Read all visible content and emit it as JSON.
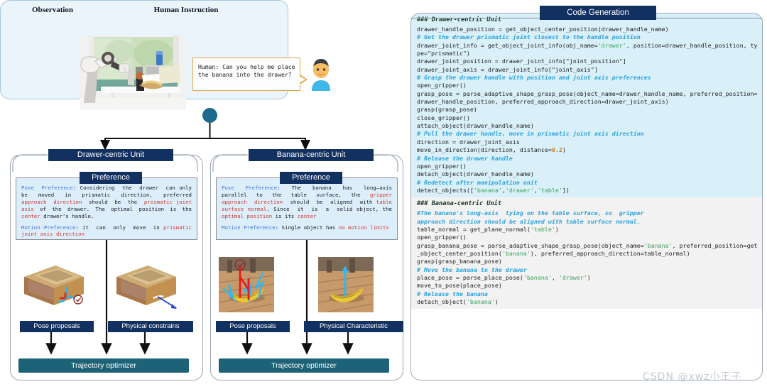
{
  "top_panel": {
    "observation_heading": "Observation",
    "instruction_heading": "Human Instruction",
    "bubble_text": "Human: Can you help me place\nthe banana into the drawer?"
  },
  "units": [
    {
      "title": "Drawer-centric Unit",
      "preference_label": "Preference",
      "pose_preference_key": "Pose Preference",
      "motion_preference_key": "Motion Preference",
      "caption_left": "Pose proposals",
      "caption_right": "Physical constrains",
      "optimizer": "Trajectory optimizer"
    },
    {
      "title": "Banana-centric Unit",
      "preference_label": "Preference",
      "pose_preference_key": "Pose Preference",
      "motion_preference_key": "Motion Preference",
      "caption_left": "Pose proposals",
      "caption_right": "Physical Characteristic",
      "optimizer": "Trajectory optimizer"
    }
  ],
  "code_panel": {
    "title": "Code Generation",
    "sections": [
      {
        "heading": "### Drawer-centric Unit",
        "code": "drawer_handle_position = get_object_center_position(drawer_handle_name)\n# Get the drawer prismatic joint closest to the handle position\ndrawer_joint_info = get_object_joint_info(obj_name='drawer', position=drawer_handle_position, type=\"prismatic\")\ndrawer_joint_position = drawer_joint_info[\"joint_position\"]\ndrawer_joint_axis = drawer_joint_info[\"joint_axis\"]\n# Grasp the drawer handle with position and joint axis preferences\nopen_gripper()\ngrasp_pose = parse_adaptive_shape_grasp_pose(object_name=drawer_handle_name, preferred_position=drawer_handle_position, preferred_approach_direction=drawer_joint_axis)\ngrasp(grasp_pose)\nclose_gripper()\nattach_object(drawer_handle_name)\n# Pull the drawer handle, move in prismatic joint axis direction\ndirection = drawer_joint_axis\nmove_in_direction(direction, distance=0.2)\n# Release the drawer handle\nopen_gripper()\ndetach_object(drawer_handle_name)\n# Redetect after manipulation unit\ndetect_objects(['banana','drawer','table'])"
      },
      {
        "heading": "### Banana-centric Unit",
        "code": "#The banana's long-axis  lying on the table surface, so  gripper\napproach direction should be aligned with table surface normal.\ntable_normal = get_plane_normal('table')\nopen_gripper()\ngrasp_banana_pose = parse_adaptive_shape_grasp_pose(object_name='banana', preferred_position=get_object_center_position('banana'), preferred_approach_direction=table_normal)\ngrasp(grasp_banana_pose)\n# Move the banana to the drawer\nplace_pose = parse_place_pose('banana', 'drawer')\nmove_to_pose(place_pose)\n# Release the banana\ndetach_object('banana')"
      }
    ]
  },
  "watermark": "CSDN @xwz小王子",
  "colors": {
    "navy": "#123060",
    "teal": "#1d6277",
    "panel_blue": "#eaf4fb",
    "pref_blue": "#ddeefb",
    "code_blue": "#d9f0f8",
    "code_gray": "#f2f2f2",
    "keyword_blue": "#3f74e0",
    "highlight_red": "#d2342e"
  }
}
